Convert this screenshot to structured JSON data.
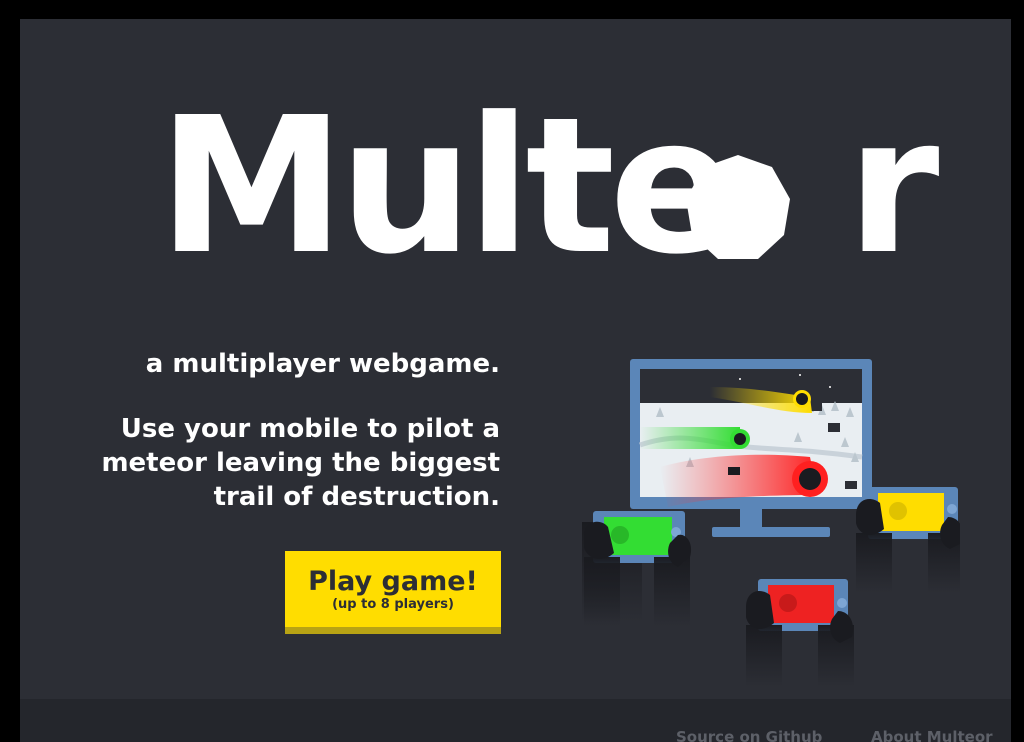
{
  "logo": {
    "text": "Multeor"
  },
  "hero": {
    "tagline": "a multiplayer webgame.",
    "description": "Use your mobile to pilot a meteor leaving the biggest trail of destruction."
  },
  "play_button": {
    "label": "Play game!",
    "sublabel": "(up to 8 players)"
  },
  "footer": {
    "source_link": "Source on Github",
    "about_link": "About Multeor"
  },
  "colors": {
    "background": "#2c2e35",
    "footer": "#24262c",
    "accent_yellow": "#ffdd00",
    "player_green": "#33dd33",
    "player_red": "#ee2222",
    "player_yellow": "#ffdd00",
    "device_blue": "#5b86b8"
  },
  "illustration": {
    "icons": [
      "monitor-icon",
      "phone-controller-icon",
      "meteor-icon"
    ]
  }
}
